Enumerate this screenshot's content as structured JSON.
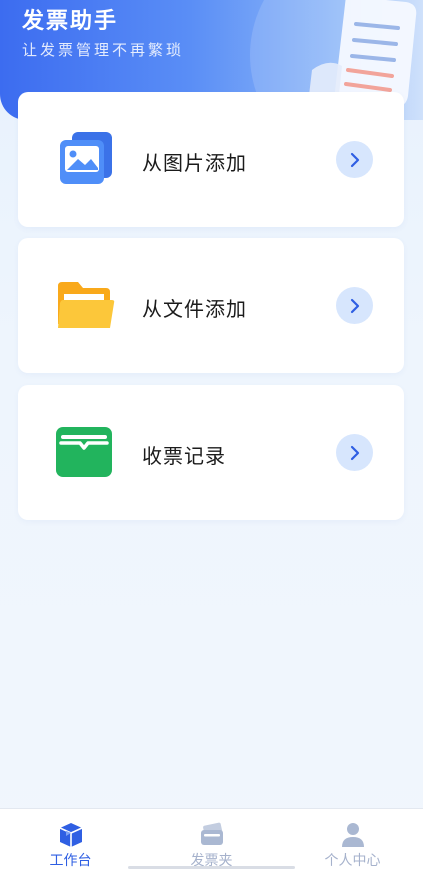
{
  "header": {
    "title": "发票助手",
    "subtitle": "让发票管理不再繁琐"
  },
  "cards": [
    {
      "label": "从图片添加",
      "icon": "image-gallery-icon"
    },
    {
      "label": "从文件添加",
      "icon": "folder-icon"
    },
    {
      "label": "收票记录",
      "icon": "wallet-icon"
    }
  ],
  "tabbar": {
    "items": [
      {
        "label": "工作台",
        "icon": "box-icon",
        "active": true
      },
      {
        "label": "发票夹",
        "icon": "invoice-folder-icon",
        "active": false
      },
      {
        "label": "个人中心",
        "icon": "person-icon",
        "active": false
      }
    ]
  },
  "colors": {
    "primary": "#2f5fe3",
    "header_start": "#3c6cf0",
    "header_end": "#c7dcfb",
    "arrow_bg": "#d7e6fd",
    "folder": "#fbbf24",
    "wallet": "#22b45d",
    "inactive": "#a6b2cc"
  }
}
